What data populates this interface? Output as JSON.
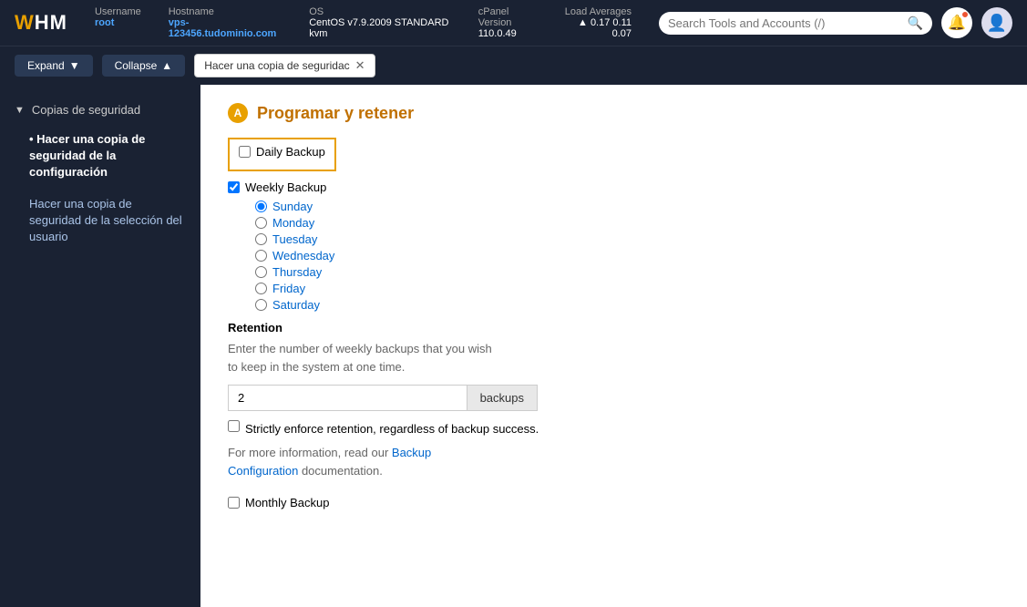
{
  "topbar": {
    "logo": "WHM",
    "username_label": "Username",
    "username_value": "root",
    "hostname_label": "Hostname",
    "hostname_value": "vps-123456.tudominio.com",
    "os_label": "OS",
    "os_value": "CentOS v7.9.2009 STANDARD kvm",
    "cpanel_label": "cPanel Version",
    "cpanel_value": "110.0.49",
    "load_label": "Load Averages",
    "load_up": "▲",
    "load_values": "0.17  0.11  0.07"
  },
  "secondbar": {
    "expand_label": "Expand",
    "collapse_label": "Collapse",
    "breadcrumb_text": "Hacer una copia de seguridac"
  },
  "search": {
    "placeholder": "Search Tools and Accounts (/)"
  },
  "sidebar": {
    "section": "Copias de seguridad",
    "items": [
      {
        "label": "Hacer una copia de seguridad de la configuración",
        "active": true
      },
      {
        "label": "Hacer una copia de seguridad de la selección del usuario",
        "active": false
      }
    ]
  },
  "main": {
    "section_title": "Programar y retener",
    "annotation": "A",
    "daily_label": "Daily Backup",
    "weekly_label": "Weekly Backup",
    "weekly_days": [
      "Sunday",
      "Monday",
      "Tuesday",
      "Wednesday",
      "Thursday",
      "Friday",
      "Saturday"
    ],
    "weekly_checked": true,
    "retention_heading": "Retention",
    "retention_desc_line1": "Enter the number of weekly backups that you wish",
    "retention_desc_line2": "to keep in the system at one time.",
    "retention_value": "2",
    "retention_suffix": "backups",
    "enforce_label": "Strictly enforce retention, regardless of backup success.",
    "info_text_before": "For more information, read our ",
    "info_link1": "Backup",
    "info_text_mid": "\nConfiguration",
    "info_link2": "Configuration",
    "info_text_after": " documentation.",
    "monthly_label": "Monthly Backup"
  }
}
